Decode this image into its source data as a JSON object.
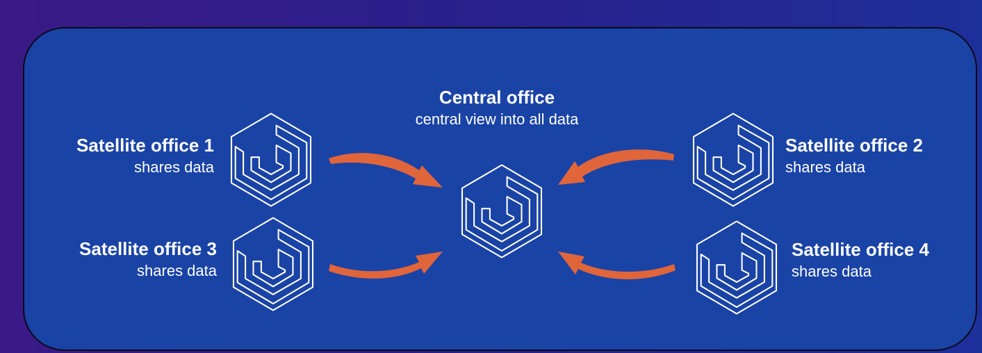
{
  "central": {
    "name": "Central office",
    "description": "central view into all data"
  },
  "satellites": [
    {
      "name": "Satellite office 1",
      "description": "shares data"
    },
    {
      "name": "Satellite office 2",
      "description": "shares data"
    },
    {
      "name": "Satellite office 3",
      "description": "shares data"
    },
    {
      "name": "Satellite office 4",
      "description": "shares data"
    }
  ],
  "colors": {
    "background": "#1a43a6",
    "arrow": "#e0653a",
    "outline": "#ffffff"
  },
  "icon": "hexagon-logo-icon"
}
